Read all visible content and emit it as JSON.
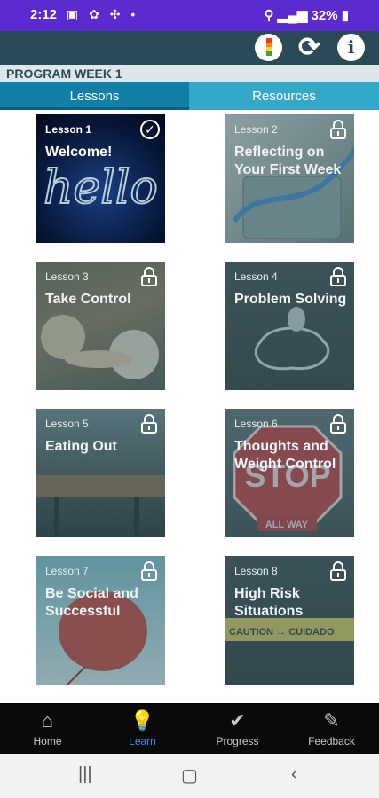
{
  "status_bar": {
    "time": "2:12",
    "battery": "32%"
  },
  "header": {
    "week_label": "PROGRAM WEEK 1",
    "tabs": [
      {
        "label": "Lessons",
        "active": true
      },
      {
        "label": "Resources",
        "active": false
      }
    ]
  },
  "lessons": [
    {
      "number": "Lesson 1",
      "title": "Welcome!",
      "locked": false,
      "completed": true
    },
    {
      "number": "Lesson 2",
      "title": "Reflecting on Your First Week",
      "locked": true,
      "completed": false
    },
    {
      "number": "Lesson 3",
      "title": "Take Control",
      "locked": true,
      "completed": false
    },
    {
      "number": "Lesson 4",
      "title": "Problem Solving",
      "locked": true,
      "completed": false
    },
    {
      "number": "Lesson 5",
      "title": "Eating Out",
      "locked": true,
      "completed": false
    },
    {
      "number": "Lesson 6",
      "title": "Thoughts and Weight Control",
      "locked": true,
      "completed": false
    },
    {
      "number": "Lesson 7",
      "title": "Be Social and Successful",
      "locked": true,
      "completed": false
    },
    {
      "number": "Lesson 8",
      "title": "High Risk Situations",
      "locked": true,
      "completed": false
    }
  ],
  "image_text": {
    "hello": "hello",
    "stop": "STOP",
    "all_way": "ALL WAY",
    "caution": "CAUTION → CUIDADO"
  },
  "bottom_nav": [
    {
      "label": "Home",
      "icon": "home-icon",
      "active": false
    },
    {
      "label": "Learn",
      "icon": "lightbulb-icon",
      "active": true
    },
    {
      "label": "Progress",
      "icon": "checkmark-icon",
      "active": false
    },
    {
      "label": "Feedback",
      "icon": "feedback-icon",
      "active": false
    }
  ],
  "colors": {
    "status_bar": "#5b2bd1",
    "app_bar": "#2a4a57",
    "tab_active": "#127fa8",
    "tab_inactive": "#34a8c8",
    "nav_active": "#3b8cff"
  }
}
